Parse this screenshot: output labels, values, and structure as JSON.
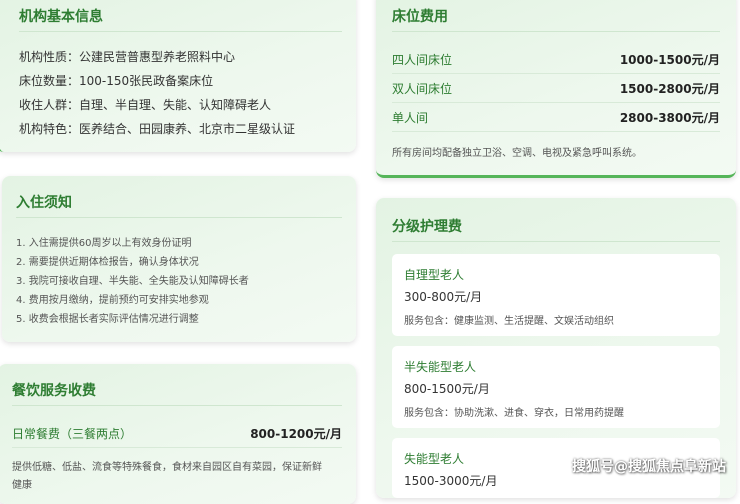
{
  "basic_info": {
    "title": "机构基本信息",
    "lines": [
      "机构性质：公建民营普惠型养老照料中心",
      "床位数量：100-150张民政备案床位",
      "收住人群：自理、半自理、失能、认知障碍老人",
      "机构特色：医养结合、田园康养、北京市二星级认证"
    ]
  },
  "admission": {
    "title": "入住须知",
    "rules": [
      "1. 入住需提供60周岁以上有效身份证明",
      "2. 需要提供近期体检报告，确认身体状况",
      "3. 我院可接收自理、半失能、全失能及认知障碍长者",
      "4. 费用按月缴纳，提前预约可安排实地参观",
      "5. 收费会根据长者实际评估情况进行调整"
    ]
  },
  "catering": {
    "title": "餐饮服务收费",
    "item_name": "日常餐费（三餐两点）",
    "item_price": "800-1200元/月",
    "desc": "提供低糖、低盐、流食等特殊餐食，食材来自园区自有菜园，保证新鲜",
    "desc_cont": "健康"
  },
  "bed_fees": {
    "title": "床位费用",
    "rows": [
      {
        "name": "四人间床位",
        "price": "1000-1500元/月"
      },
      {
        "name": "双人间床位",
        "price": "1500-2800元/月"
      },
      {
        "name": "单人间",
        "price": "2800-3800元/月"
      }
    ],
    "note": "所有房间均配备独立卫浴、空调、电视及紧急呼叫系统。"
  },
  "care_fees": {
    "title": "分级护理费",
    "levels": [
      {
        "name": "自理型老人",
        "price": "300-800元/月",
        "desc": "服务包含：健康监测、生活提醒、文娱活动组织"
      },
      {
        "name": "半失能型老人",
        "price": "800-1500元/月",
        "desc": "服务包含：协助洗漱、进食、穿衣，日常用药提醒"
      },
      {
        "name": "失能型老人",
        "price": "1500-3000元/月",
        "desc": ""
      }
    ]
  },
  "watermark": "搜狐号@搜狐焦点阜新站",
  "colors": {
    "accent": "#55b559",
    "title_green": "#2e7d32",
    "card_bg": "#e8f5e9"
  }
}
